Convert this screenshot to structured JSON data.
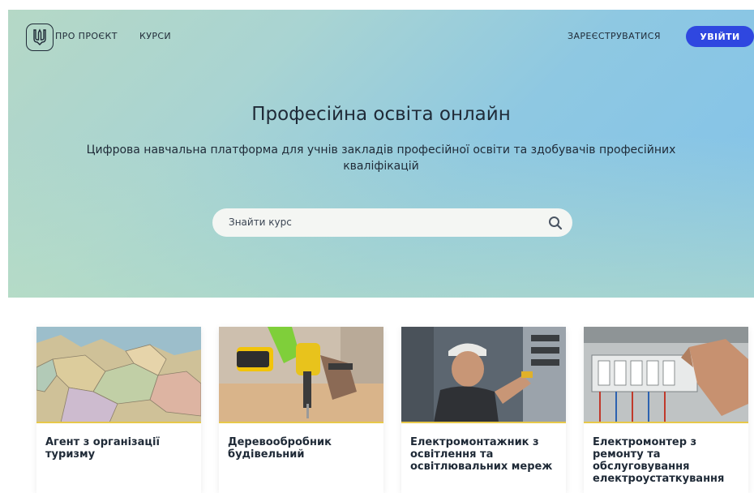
{
  "nav": {
    "about": "ПРО ПРОЄКТ",
    "courses": "КУРСИ",
    "register": "ЗАРЕЄСТРУВАТИСЯ",
    "login": "УВІЙТИ",
    "logo_icon": "trident-icon"
  },
  "hero": {
    "title": "Професійна освіта онлайн",
    "subtitle": "Цифрова навчальна платформа для учнів закладів професійної освіти та здобувачів професійних кваліфікацій"
  },
  "search": {
    "placeholder": "Знайти курс",
    "icon": "search-icon"
  },
  "courses": [
    {
      "title": "Агент з організації туризму",
      "image": "map-photo"
    },
    {
      "title": "Деревообробник будівельний",
      "image": "drill-photo"
    },
    {
      "title": "Електромонтажник з освітлення та освітлювальних мереж",
      "image": "electrician-photo"
    },
    {
      "title": "Електромонтер з ремонту та обслуговування електроустаткування",
      "image": "breaker-panel-photo"
    }
  ],
  "colors": {
    "accent": "#2f47e0",
    "card_underline": "#e7c84a",
    "text": "#1f2a37"
  }
}
